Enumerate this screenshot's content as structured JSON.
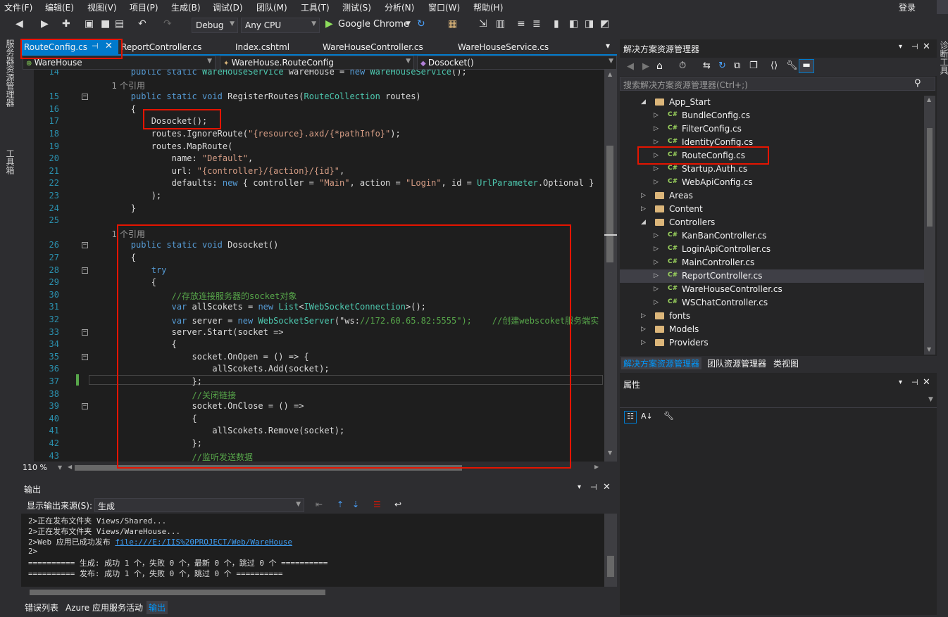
{
  "menu": [
    "文件(F)",
    "编辑(E)",
    "视图(V)",
    "项目(P)",
    "生成(B)",
    "调试(D)",
    "团队(M)",
    "工具(T)",
    "测试(S)",
    "分析(N)",
    "窗口(W)",
    "帮助(H)"
  ],
  "login": "登录",
  "toolbar": {
    "config": "Debug",
    "platform": "Any CPU",
    "browser": "Google Chrome"
  },
  "left_tabs": [
    "服务器资源管理器",
    "工具箱"
  ],
  "right_tab": "诊断工具",
  "editor_tabs": [
    "RouteConfig.cs",
    "ReportController.cs",
    "Index.cshtml",
    "WareHouseController.cs",
    "WareHouseService.cs"
  ],
  "nav": {
    "project": "WareHouse",
    "class": "WareHouse.RouteConfig",
    "member": "Dosocket()"
  },
  "code_lines": [
    {
      "n": "14",
      "t": "        public static WareHouseService wareHouse = new WareHouseService();"
    },
    {
      "n": "",
      "t": "        1 个引用",
      "ref": true
    },
    {
      "n": "15",
      "t": "        public static void RegisterRoutes(RouteCollection routes)"
    },
    {
      "n": "16",
      "t": "        {"
    },
    {
      "n": "17",
      "t": "            Dosocket();"
    },
    {
      "n": "18",
      "t": "            routes.IgnoreRoute(\"{resource}.axd/{*pathInfo}\");"
    },
    {
      "n": "19",
      "t": "            routes.MapRoute("
    },
    {
      "n": "20",
      "t": "                name: \"Default\","
    },
    {
      "n": "21",
      "t": "                url: \"{controller}/{action}/{id}\","
    },
    {
      "n": "22",
      "t": "                defaults: new { controller = \"Main\", action = \"Login\", id = UrlParameter.Optional }"
    },
    {
      "n": "23",
      "t": "            );"
    },
    {
      "n": "24",
      "t": "        }"
    },
    {
      "n": "25",
      "t": ""
    },
    {
      "n": "",
      "t": "        1 个引用",
      "ref": true
    },
    {
      "n": "26",
      "t": "        public static void Dosocket()"
    },
    {
      "n": "27",
      "t": "        {"
    },
    {
      "n": "28",
      "t": "            try"
    },
    {
      "n": "29",
      "t": "            {"
    },
    {
      "n": "30",
      "t": "                //存放连接服务器的socket对象"
    },
    {
      "n": "31",
      "t": "                var allScokets = new List<IWebSocketConnection>();"
    },
    {
      "n": "32",
      "t": "                var server = new WebSocketServer(\"ws://172.60.65.82:5555\");    //创建webscoket服务端实"
    },
    {
      "n": "33",
      "t": "                server.Start(socket =>"
    },
    {
      "n": "34",
      "t": "                {"
    },
    {
      "n": "35",
      "t": "                    socket.OnOpen = () => {"
    },
    {
      "n": "36",
      "t": "                        allScokets.Add(socket);"
    },
    {
      "n": "37",
      "t": "                    };"
    },
    {
      "n": "38",
      "t": "                    //关闭链接"
    },
    {
      "n": "39",
      "t": "                    socket.OnClose = () =>"
    },
    {
      "n": "40",
      "t": "                    {"
    },
    {
      "n": "41",
      "t": "                        allScokets.Remove(socket);"
    },
    {
      "n": "42",
      "t": "                    };"
    },
    {
      "n": "43",
      "t": "                    //监听发送数据"
    }
  ],
  "zoom": "110 %",
  "output": {
    "title": "输出",
    "source_label": "显示输出来源(S):",
    "source_value": "生成",
    "lines": [
      "2>正在发布文件夹 Views/Shared...",
      "2>正在发布文件夹 Views/WareHouse...",
      "2>Web 应用已成功发布 file:///E:/IIS%20PROJECT/Web/WareHouse",
      "2>",
      "========== 生成: 成功 1 个，失败 0 个，最新 0 个，跳过 0 个 ==========",
      "========== 发布: 成功 1 个，失败 0 个，跳过 0 个 =========="
    ]
  },
  "bottom_tabs": [
    "错误列表",
    "Azure 应用服务活动",
    "输出"
  ],
  "solution": {
    "title": "解决方案资源管理器",
    "search_placeholder": "搜索解决方案资源管理器(Ctrl+;)",
    "items": [
      {
        "label": "App_Start",
        "kind": "folder",
        "expanded": true,
        "level": 1
      },
      {
        "label": "BundleConfig.cs",
        "kind": "cs",
        "level": 2
      },
      {
        "label": "FilterConfig.cs",
        "kind": "cs",
        "level": 2
      },
      {
        "label": "IdentityConfig.cs",
        "kind": "cs",
        "level": 2
      },
      {
        "label": "RouteConfig.cs",
        "kind": "cs",
        "level": 2
      },
      {
        "label": "Startup.Auth.cs",
        "kind": "cs",
        "level": 2
      },
      {
        "label": "WebApiConfig.cs",
        "kind": "cs",
        "level": 2
      },
      {
        "label": "Areas",
        "kind": "folder",
        "level": 1
      },
      {
        "label": "Content",
        "kind": "folder",
        "level": 1
      },
      {
        "label": "Controllers",
        "kind": "folder",
        "expanded": true,
        "level": 1
      },
      {
        "label": "KanBanController.cs",
        "kind": "cs",
        "level": 2
      },
      {
        "label": "LoginApiController.cs",
        "kind": "cs",
        "level": 2
      },
      {
        "label": "MainController.cs",
        "kind": "cs",
        "level": 2
      },
      {
        "label": "ReportController.cs",
        "kind": "cs",
        "level": 2,
        "selected": true
      },
      {
        "label": "WareHouseController.cs",
        "kind": "cs",
        "level": 2
      },
      {
        "label": "WSChatController.cs",
        "kind": "cs",
        "level": 2
      },
      {
        "label": "fonts",
        "kind": "folder",
        "level": 1
      },
      {
        "label": "Models",
        "kind": "folder",
        "level": 1
      },
      {
        "label": "Providers",
        "kind": "folder",
        "level": 1
      }
    ],
    "tabs": [
      "解决方案资源管理器",
      "团队资源管理器",
      "类视图"
    ]
  },
  "properties": {
    "title": "属性"
  },
  "colors": {
    "accent": "#007acc",
    "highlight": "#e51400",
    "keyword": "#569cd6",
    "type": "#4ec9b0",
    "string": "#d69d85",
    "comment": "#57a64a",
    "linenumber": "#2b91af"
  }
}
